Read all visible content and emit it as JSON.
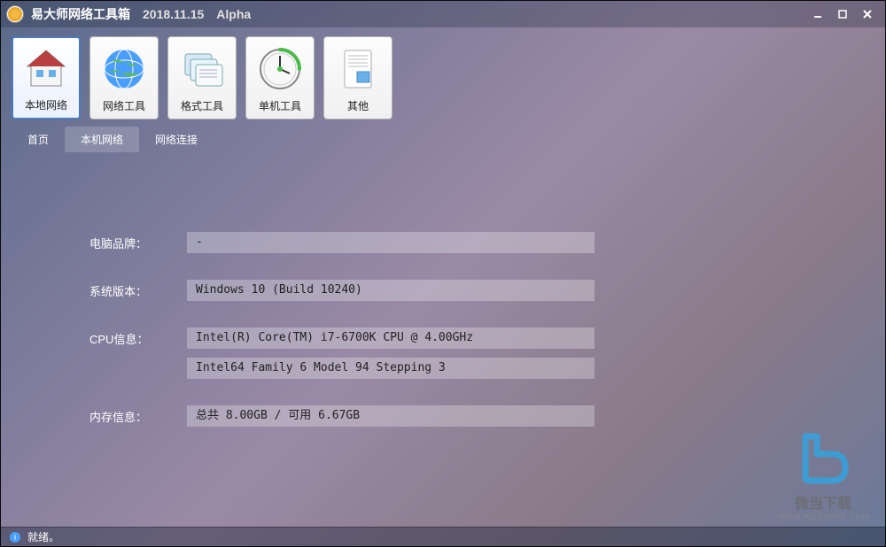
{
  "titlebar": {
    "app_name": "易大师网络工具箱",
    "version": "2018.11.15",
    "channel": "Alpha"
  },
  "toolbar": [
    {
      "label": "本地网络",
      "icon": "home-icon",
      "active": true
    },
    {
      "label": "网络工具",
      "icon": "globe-icon",
      "active": false
    },
    {
      "label": "格式工具",
      "icon": "folders-icon",
      "active": false
    },
    {
      "label": "单机工具",
      "icon": "clock-icon",
      "active": false
    },
    {
      "label": "其他",
      "icon": "document-icon",
      "active": false
    }
  ],
  "tabs": [
    {
      "label": "首页",
      "active": false
    },
    {
      "label": "本机网络",
      "active": true
    },
    {
      "label": "网络连接",
      "active": false
    }
  ],
  "info": {
    "brand_label": "电脑品牌：",
    "brand_value": " -",
    "os_label": "系统版本：",
    "os_value": "Windows 10 (Build 10240)",
    "cpu_label": "CPU信息：",
    "cpu_value1": "Intel(R) Core(TM) i7-6700K CPU @ 4.00GHz",
    "cpu_value2": "Intel64 Family 6 Model 94 Stepping 3",
    "mem_label": "内存信息：",
    "mem_value": "总共 8.00GB / 可用 6.67GB"
  },
  "statusbar": {
    "text": "就绪。"
  },
  "watermark": {
    "text": "微当下载",
    "url": "WWW.WEIDOWN.COM"
  }
}
